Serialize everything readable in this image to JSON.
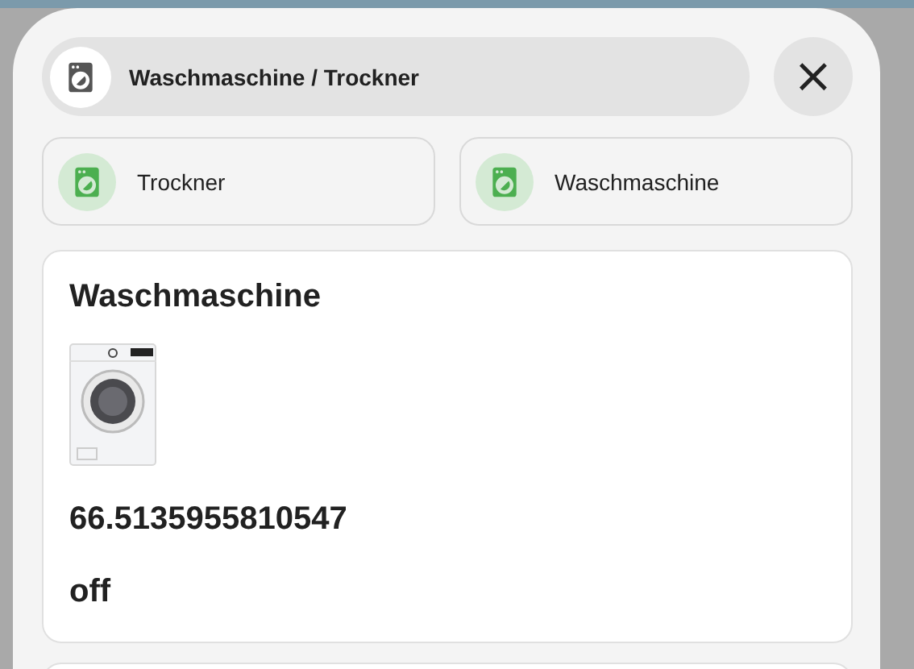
{
  "dialog": {
    "title": "Waschmaschine / Trockner",
    "close": "×"
  },
  "chips": [
    {
      "label": "Trockner",
      "on": true
    },
    {
      "label": "Waschmaschine",
      "on": true
    }
  ],
  "card": {
    "title": "Waschmaschine",
    "value": "66.5135955810547",
    "state": "off"
  }
}
